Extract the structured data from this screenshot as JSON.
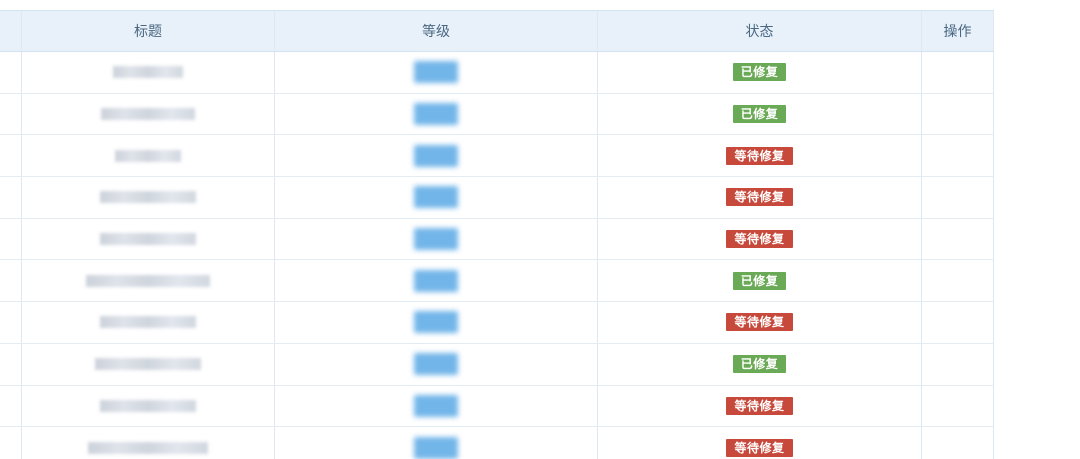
{
  "table": {
    "headers": {
      "title": "标题",
      "level": "等级",
      "status": "状态",
      "action": "操作"
    },
    "rows": [
      {
        "status": "已修复",
        "status_type": "fixed"
      },
      {
        "status": "已修复",
        "status_type": "fixed"
      },
      {
        "status": "等待修复",
        "status_type": "pending"
      },
      {
        "status": "等待修复",
        "status_type": "pending"
      },
      {
        "status": "等待修复",
        "status_type": "pending"
      },
      {
        "status": "已修复",
        "status_type": "fixed"
      },
      {
        "status": "等待修复",
        "status_type": "pending"
      },
      {
        "status": "已修复",
        "status_type": "fixed"
      },
      {
        "status": "等待修复",
        "status_type": "pending"
      },
      {
        "status": "等待修复",
        "status_type": "pending"
      }
    ]
  },
  "colors": {
    "header_bg": "#e8f1f9",
    "fixed": "#6aa955",
    "pending": "#c7493b",
    "level_blur": "#5aa9e6"
  }
}
